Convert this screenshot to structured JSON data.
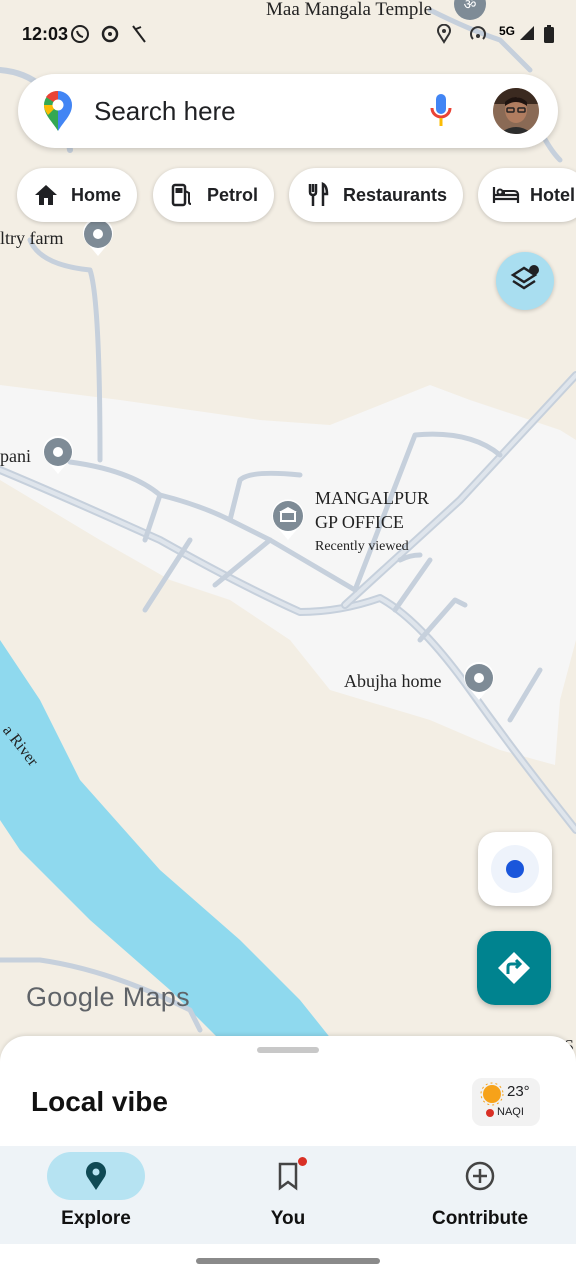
{
  "status": {
    "time": "12:03",
    "network": "5G"
  },
  "search": {
    "placeholder": "Search here"
  },
  "chips": [
    {
      "label": "Home",
      "icon": "home-icon"
    },
    {
      "label": "Petrol",
      "icon": "fuel-icon"
    },
    {
      "label": "Restaurants",
      "icon": "restaurant-icon"
    },
    {
      "label": "Hotel",
      "icon": "hotel-icon"
    }
  ],
  "map": {
    "labels": {
      "temple": "Maa Mangala Temple",
      "poultry": "ltry farm",
      "left_place": "pani",
      "office_line1": "MANGALPUR",
      "office_line2": "GP OFFICE",
      "office_sub": "Recently viewed",
      "home": "Abujha home",
      "river": "a River",
      "right_edge": "S"
    },
    "colors": {
      "land": "#f3eee4",
      "urban": "#f6f6f6",
      "river": "#8fd9ee",
      "road": "#c6d0dc",
      "pin": "#7e8b96"
    }
  },
  "watermark": {
    "google": "Google",
    "maps": "Maps"
  },
  "sheet": {
    "title": "Local vibe",
    "weather_temp": "23°",
    "weather_aqi": "NAQI"
  },
  "nav": [
    {
      "label": "Explore",
      "icon": "explore-pin-icon",
      "active": true
    },
    {
      "label": "You",
      "icon": "bookmark-icon",
      "badge": true
    },
    {
      "label": "Contribute",
      "icon": "add-circle-icon"
    }
  ],
  "colors": {
    "accent_teal": "#00838f",
    "nav_active_pill": "#b6e3f2",
    "location_dot": "#1a56db"
  }
}
